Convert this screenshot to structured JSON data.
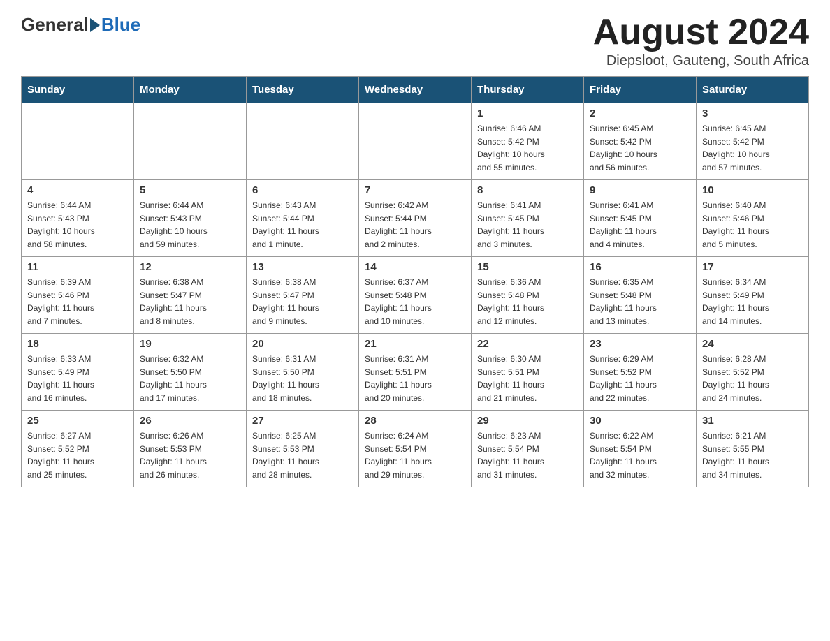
{
  "header": {
    "logo_general": "General",
    "logo_blue": "Blue",
    "month_title": "August 2024",
    "location": "Diepsloot, Gauteng, South Africa"
  },
  "weekdays": [
    "Sunday",
    "Monday",
    "Tuesday",
    "Wednesday",
    "Thursday",
    "Friday",
    "Saturday"
  ],
  "weeks": [
    [
      {
        "day": "",
        "info": ""
      },
      {
        "day": "",
        "info": ""
      },
      {
        "day": "",
        "info": ""
      },
      {
        "day": "",
        "info": ""
      },
      {
        "day": "1",
        "info": "Sunrise: 6:46 AM\nSunset: 5:42 PM\nDaylight: 10 hours\nand 55 minutes."
      },
      {
        "day": "2",
        "info": "Sunrise: 6:45 AM\nSunset: 5:42 PM\nDaylight: 10 hours\nand 56 minutes."
      },
      {
        "day": "3",
        "info": "Sunrise: 6:45 AM\nSunset: 5:42 PM\nDaylight: 10 hours\nand 57 minutes."
      }
    ],
    [
      {
        "day": "4",
        "info": "Sunrise: 6:44 AM\nSunset: 5:43 PM\nDaylight: 10 hours\nand 58 minutes."
      },
      {
        "day": "5",
        "info": "Sunrise: 6:44 AM\nSunset: 5:43 PM\nDaylight: 10 hours\nand 59 minutes."
      },
      {
        "day": "6",
        "info": "Sunrise: 6:43 AM\nSunset: 5:44 PM\nDaylight: 11 hours\nand 1 minute."
      },
      {
        "day": "7",
        "info": "Sunrise: 6:42 AM\nSunset: 5:44 PM\nDaylight: 11 hours\nand 2 minutes."
      },
      {
        "day": "8",
        "info": "Sunrise: 6:41 AM\nSunset: 5:45 PM\nDaylight: 11 hours\nand 3 minutes."
      },
      {
        "day": "9",
        "info": "Sunrise: 6:41 AM\nSunset: 5:45 PM\nDaylight: 11 hours\nand 4 minutes."
      },
      {
        "day": "10",
        "info": "Sunrise: 6:40 AM\nSunset: 5:46 PM\nDaylight: 11 hours\nand 5 minutes."
      }
    ],
    [
      {
        "day": "11",
        "info": "Sunrise: 6:39 AM\nSunset: 5:46 PM\nDaylight: 11 hours\nand 7 minutes."
      },
      {
        "day": "12",
        "info": "Sunrise: 6:38 AM\nSunset: 5:47 PM\nDaylight: 11 hours\nand 8 minutes."
      },
      {
        "day": "13",
        "info": "Sunrise: 6:38 AM\nSunset: 5:47 PM\nDaylight: 11 hours\nand 9 minutes."
      },
      {
        "day": "14",
        "info": "Sunrise: 6:37 AM\nSunset: 5:48 PM\nDaylight: 11 hours\nand 10 minutes."
      },
      {
        "day": "15",
        "info": "Sunrise: 6:36 AM\nSunset: 5:48 PM\nDaylight: 11 hours\nand 12 minutes."
      },
      {
        "day": "16",
        "info": "Sunrise: 6:35 AM\nSunset: 5:48 PM\nDaylight: 11 hours\nand 13 minutes."
      },
      {
        "day": "17",
        "info": "Sunrise: 6:34 AM\nSunset: 5:49 PM\nDaylight: 11 hours\nand 14 minutes."
      }
    ],
    [
      {
        "day": "18",
        "info": "Sunrise: 6:33 AM\nSunset: 5:49 PM\nDaylight: 11 hours\nand 16 minutes."
      },
      {
        "day": "19",
        "info": "Sunrise: 6:32 AM\nSunset: 5:50 PM\nDaylight: 11 hours\nand 17 minutes."
      },
      {
        "day": "20",
        "info": "Sunrise: 6:31 AM\nSunset: 5:50 PM\nDaylight: 11 hours\nand 18 minutes."
      },
      {
        "day": "21",
        "info": "Sunrise: 6:31 AM\nSunset: 5:51 PM\nDaylight: 11 hours\nand 20 minutes."
      },
      {
        "day": "22",
        "info": "Sunrise: 6:30 AM\nSunset: 5:51 PM\nDaylight: 11 hours\nand 21 minutes."
      },
      {
        "day": "23",
        "info": "Sunrise: 6:29 AM\nSunset: 5:52 PM\nDaylight: 11 hours\nand 22 minutes."
      },
      {
        "day": "24",
        "info": "Sunrise: 6:28 AM\nSunset: 5:52 PM\nDaylight: 11 hours\nand 24 minutes."
      }
    ],
    [
      {
        "day": "25",
        "info": "Sunrise: 6:27 AM\nSunset: 5:52 PM\nDaylight: 11 hours\nand 25 minutes."
      },
      {
        "day": "26",
        "info": "Sunrise: 6:26 AM\nSunset: 5:53 PM\nDaylight: 11 hours\nand 26 minutes."
      },
      {
        "day": "27",
        "info": "Sunrise: 6:25 AM\nSunset: 5:53 PM\nDaylight: 11 hours\nand 28 minutes."
      },
      {
        "day": "28",
        "info": "Sunrise: 6:24 AM\nSunset: 5:54 PM\nDaylight: 11 hours\nand 29 minutes."
      },
      {
        "day": "29",
        "info": "Sunrise: 6:23 AM\nSunset: 5:54 PM\nDaylight: 11 hours\nand 31 minutes."
      },
      {
        "day": "30",
        "info": "Sunrise: 6:22 AM\nSunset: 5:54 PM\nDaylight: 11 hours\nand 32 minutes."
      },
      {
        "day": "31",
        "info": "Sunrise: 6:21 AM\nSunset: 5:55 PM\nDaylight: 11 hours\nand 34 minutes."
      }
    ]
  ]
}
